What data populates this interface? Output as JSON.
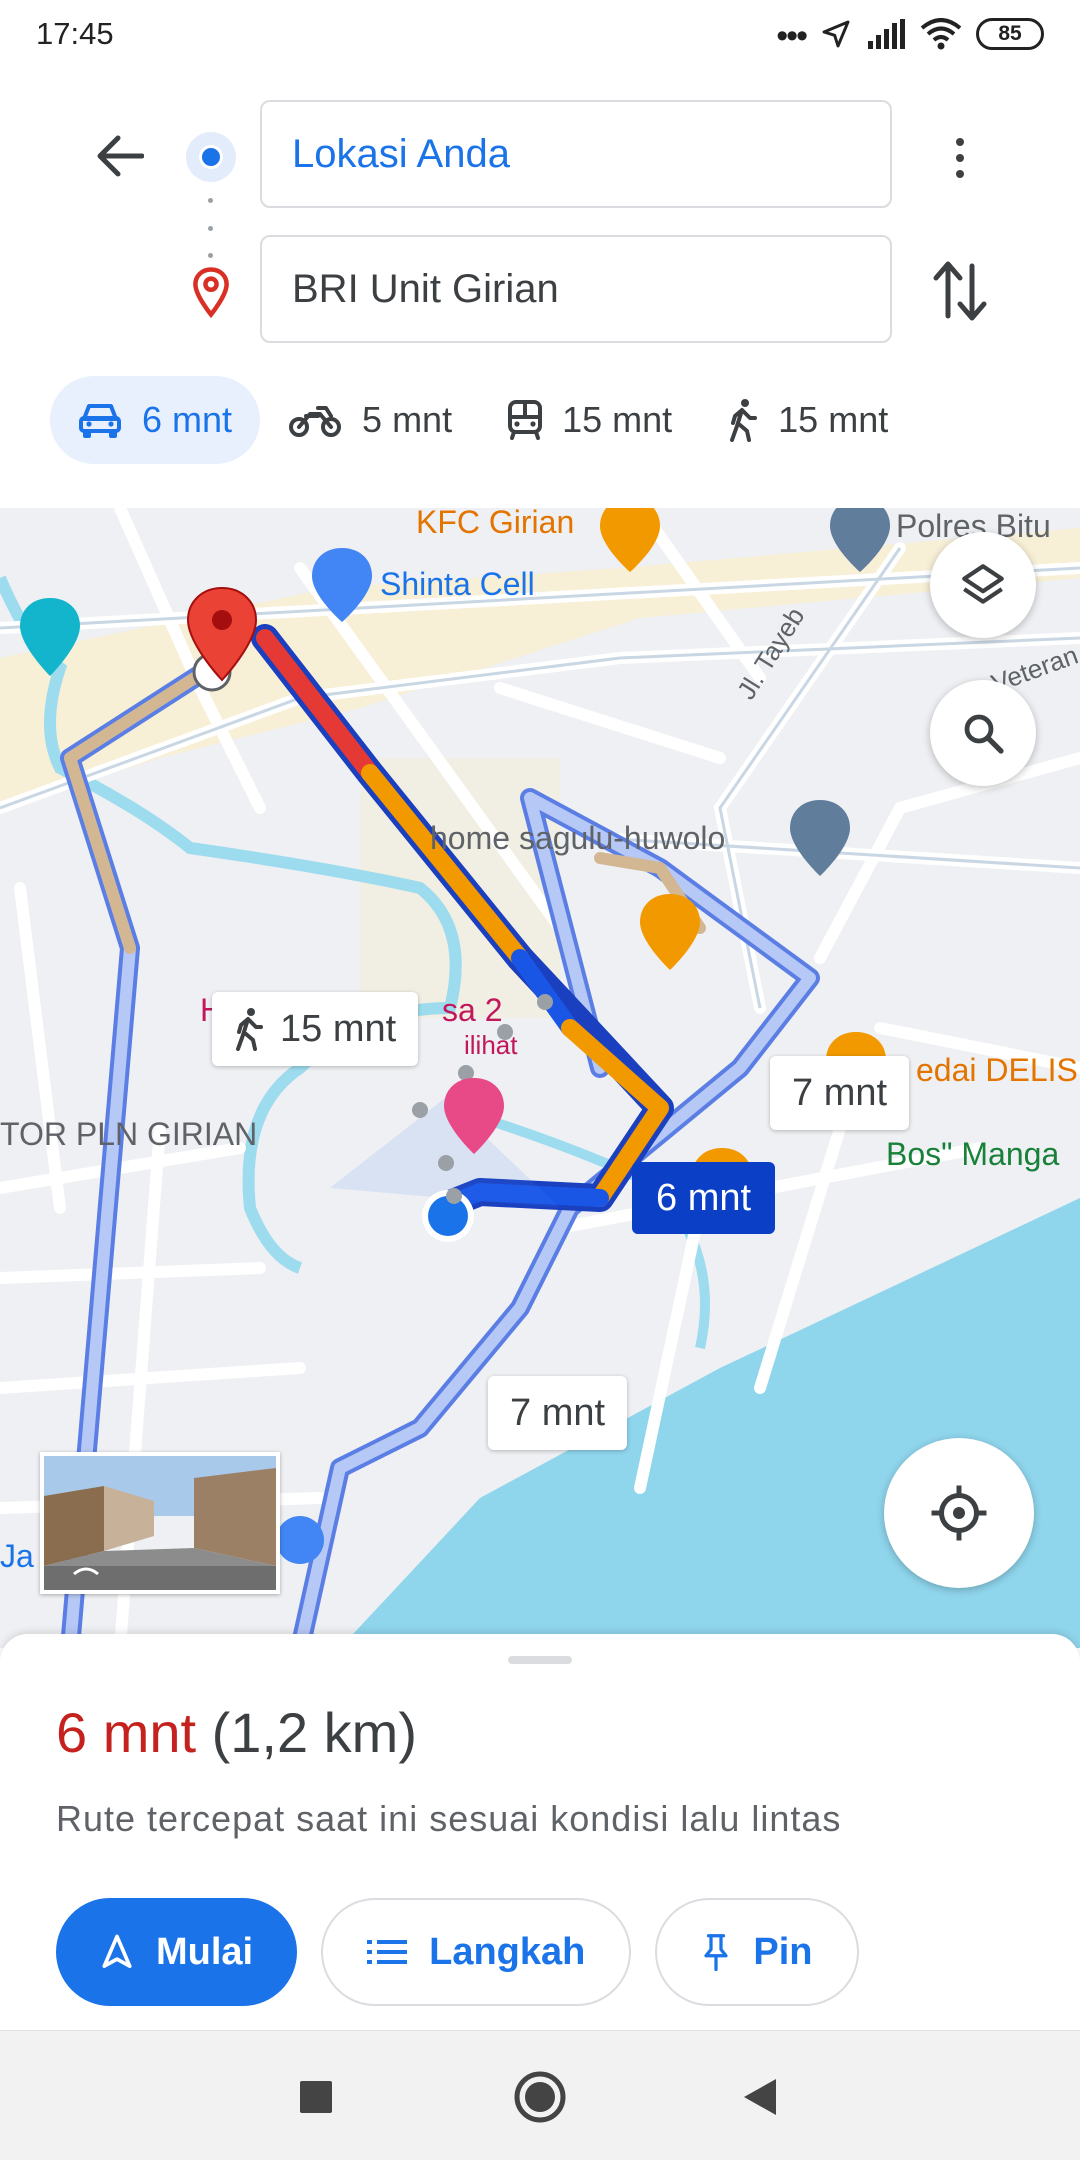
{
  "status_bar": {
    "time": "17:45",
    "battery": "85"
  },
  "search": {
    "origin": "Lokasi Anda",
    "destination": "BRI Unit Girian"
  },
  "modes": [
    {
      "name": "car",
      "label": "6 mnt",
      "active": true
    },
    {
      "name": "motorcycle",
      "label": "5 mnt",
      "active": false
    },
    {
      "name": "transit",
      "label": "15 mnt",
      "active": false
    },
    {
      "name": "walk",
      "label": "15 mnt",
      "active": false
    }
  ],
  "map": {
    "poi": {
      "kfc": "KFC Girian",
      "polres": "Polres Bitu",
      "shinta": "Shinta Cell",
      "jl_tayeb": "Jl. Tayeb",
      "veteran": "Veteran",
      "home": "home sagulu-huwolo",
      "pln": "TOR PLN GIRIAN",
      "kedai": "edai DELIS",
      "bos": "Bos\" Manga",
      "hotel_a": "H",
      "hotel_b": "sa 2",
      "hotel_c": "ilihat",
      "ja": "Ja"
    },
    "callouts": {
      "walk": "15 mnt",
      "alt1": "7 mnt",
      "main": "6 mnt",
      "alt2": "7 mnt"
    }
  },
  "sheet": {
    "time": "6 mnt",
    "distance": "(1,2 km)",
    "description": "Rute tercepat saat ini sesuai kondisi lalu lintas",
    "buttons": {
      "start": "Mulai",
      "steps": "Langkah",
      "pin": "Pin"
    }
  },
  "colors": {
    "accent": "#1a73e8",
    "traffic_red": "#e53935",
    "traffic_orange": "#f29900",
    "water": "#8fd5ec"
  }
}
